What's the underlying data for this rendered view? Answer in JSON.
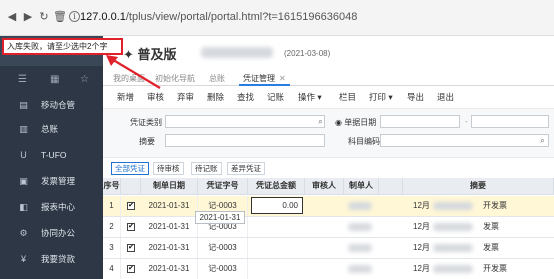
{
  "browser": {
    "url_host": "127.0.0.1",
    "url_path": "/tplus/view/portal/portal.html?t=1615196636048"
  },
  "error_tooltip": "入库失败，请至少选中2个字",
  "app": {
    "title": "普及版",
    "date": "(2021-03-08)"
  },
  "sidebar": {
    "items": [
      {
        "label": "移动仓管",
        "icon": "mobile-icon"
      },
      {
        "label": "总账",
        "icon": "ledger-icon"
      },
      {
        "label": "T-UFO",
        "icon": "ufo-icon"
      },
      {
        "label": "发票管理",
        "icon": "invoice-icon"
      },
      {
        "label": "报表中心",
        "icon": "report-icon"
      },
      {
        "label": "协同办公",
        "icon": "collab-icon"
      },
      {
        "label": "我要贷款",
        "icon": "loan-icon"
      }
    ]
  },
  "tabs": [
    {
      "label": "我的桌面"
    },
    {
      "label": "初始化导航"
    },
    {
      "label": "总账"
    },
    {
      "label": "凭证管理",
      "close": "✕"
    }
  ],
  "toolbar": {
    "items": [
      "新增",
      "审核",
      "弃审",
      "删除",
      "查找",
      "记账",
      "操作 ▾",
      "栏目",
      "打印 ▾",
      "导出",
      "退出"
    ]
  },
  "filters": {
    "voucher_type_label": "凭证类别",
    "summary_label": "摘要",
    "date_option_label": "单据日期",
    "subject_label": "科目编码"
  },
  "status_tabs": [
    "全部凭证",
    "待审核",
    "待记账",
    "差异凭证"
  ],
  "table": {
    "headers": [
      "序号",
      "",
      "制单日期",
      "凭证字号",
      "凭证总金额",
      "审核人",
      "制单人",
      "",
      "摘要"
    ],
    "date_tooltip": "2021-01-31",
    "rows": [
      {
        "seq": "1",
        "checked": "✔",
        "date": "2021-01-31",
        "voucher": "记-0003",
        "amount": "0.00",
        "summary": "12月"
      },
      {
        "seq": "2",
        "checked": "✔",
        "date": "2021-01-31",
        "voucher": "记-0003",
        "amount": "",
        "summary": "12月"
      },
      {
        "seq": "3",
        "checked": "✔",
        "date": "2021-01-31",
        "voucher": "记-0003",
        "amount": "",
        "summary": "12月"
      },
      {
        "seq": "4",
        "checked": "✔",
        "date": "2021-01-31",
        "voucher": "记-0003",
        "amount": "",
        "summary": "12月"
      }
    ],
    "extra_summary": [
      "开发票",
      "发票",
      "发票",
      "开发票"
    ]
  },
  "colors": {
    "sidebar_bg": "#2d3745",
    "error_border": "#e0202a",
    "accent": "#2a7de1"
  }
}
